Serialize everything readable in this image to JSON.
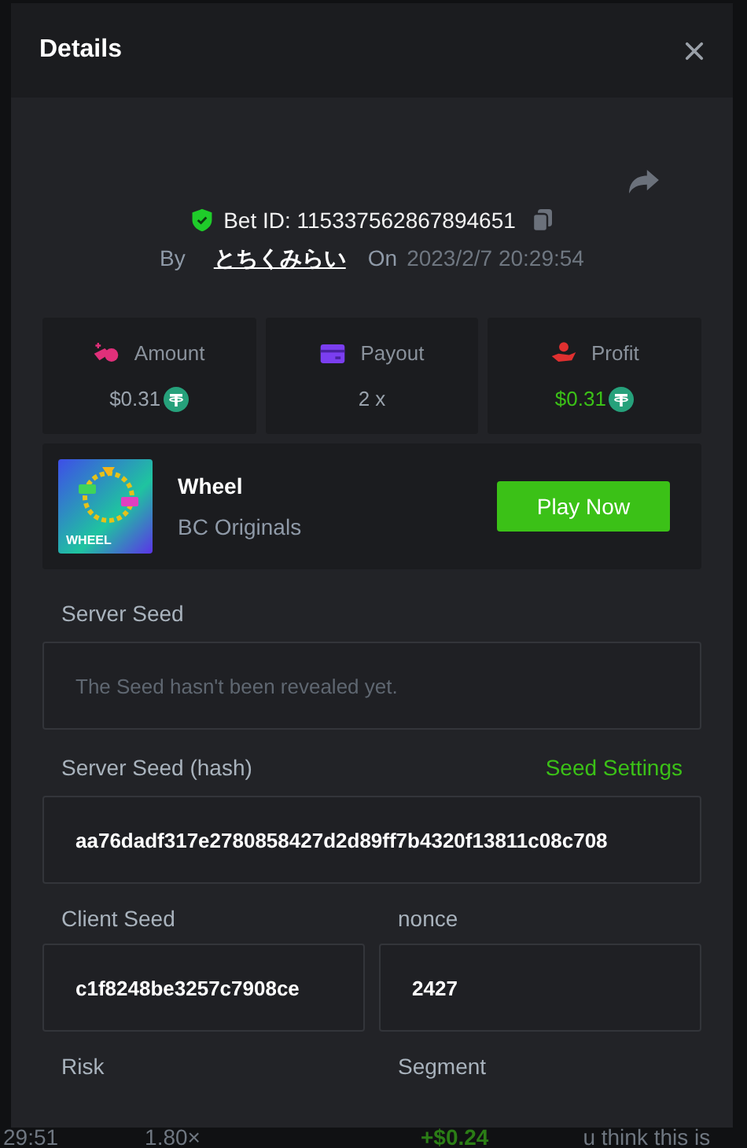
{
  "modal": {
    "title": "Details",
    "bet": {
      "verified": true,
      "id_label": "Bet ID: 115337562867894651",
      "by_label": "By",
      "user": "とちくみらい",
      "on_label": "On",
      "time": "2023/2/7 20:29:54"
    },
    "stats": [
      {
        "kind": "amount",
        "label": "Amount",
        "value": "$0.31",
        "coin": true,
        "positive": false
      },
      {
        "kind": "payout",
        "label": "Payout",
        "value": "2 x",
        "coin": false,
        "positive": false
      },
      {
        "kind": "profit",
        "label": "Profit",
        "value": "$0.31",
        "coin": true,
        "positive": true
      }
    ],
    "game": {
      "thumb_label": "WHEEL",
      "name": "Wheel",
      "provider": "BC Originals",
      "button": "Play Now"
    },
    "server_seed": {
      "label": "Server Seed",
      "placeholder": "The Seed hasn't been revealed yet."
    },
    "hash": {
      "label": "Server Seed (hash)",
      "link": "Seed Settings",
      "value": "aa76dadf317e2780858427d2d89ff7b4320f13811c08c708"
    },
    "pairs": [
      {
        "label": "Client Seed",
        "value": "c1f8248be3257c7908ce"
      },
      {
        "label": "nonce",
        "value": "2427"
      }
    ],
    "bottom_labels": [
      "Risk",
      "Segment"
    ]
  },
  "backdrop": {
    "time": "29:51",
    "multiplier": "1.80×",
    "profit": "+$0.24",
    "chat": "u think this is"
  }
}
